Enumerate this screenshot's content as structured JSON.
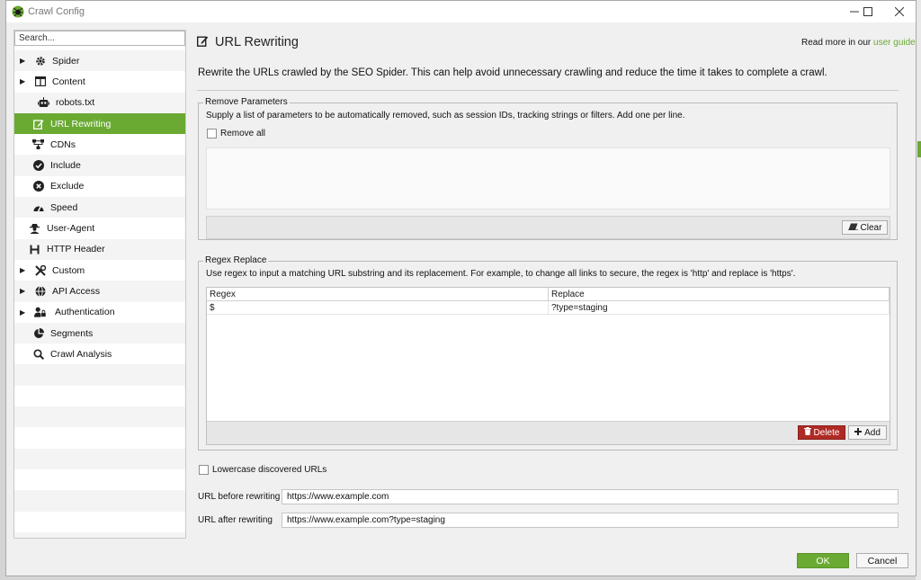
{
  "window": {
    "title": "Crawl Config",
    "controls": [
      "minimize",
      "maximize",
      "close"
    ]
  },
  "sidebar": {
    "search_placeholder": "Search...",
    "items": [
      {
        "label": "Spider",
        "icon": "gear-icon",
        "expandable": true,
        "selected": false
      },
      {
        "label": "Content",
        "icon": "columns-icon",
        "expandable": true,
        "selected": false
      },
      {
        "label": "robots.txt",
        "icon": "robot-icon",
        "expandable": false,
        "selected": false
      },
      {
        "label": "URL Rewriting",
        "icon": "edit-icon",
        "expandable": false,
        "selected": true
      },
      {
        "label": "CDNs",
        "icon": "network-icon",
        "expandable": false,
        "selected": false
      },
      {
        "label": "Include",
        "icon": "check-circle-icon",
        "expandable": false,
        "selected": false
      },
      {
        "label": "Exclude",
        "icon": "x-circle-icon",
        "expandable": false,
        "selected": false
      },
      {
        "label": "Speed",
        "icon": "speedometer-icon",
        "expandable": false,
        "selected": false
      },
      {
        "label": "User-Agent",
        "icon": "user-secret-icon",
        "expandable": false,
        "selected": false
      },
      {
        "label": "HTTP Header",
        "icon": "h-icon",
        "expandable": false,
        "selected": false
      },
      {
        "label": "Custom",
        "icon": "tools-icon",
        "expandable": true,
        "selected": false
      },
      {
        "label": "API Access",
        "icon": "globe-icon",
        "expandable": true,
        "selected": false
      },
      {
        "label": "Authentication",
        "icon": "user-lock-icon",
        "expandable": true,
        "selected": false
      },
      {
        "label": "Segments",
        "icon": "pie-chart-icon",
        "expandable": false,
        "selected": false
      },
      {
        "label": "Crawl Analysis",
        "icon": "search-icon",
        "expandable": false,
        "selected": false
      }
    ]
  },
  "header": {
    "title": "URL Rewriting",
    "read_more_prefix": "Read more in our ",
    "read_more_link": "user guide"
  },
  "description": "Rewrite the URLs crawled by the SEO Spider. This can help avoid unnecessary crawling and reduce the time it takes to complete a crawl.",
  "remove_parameters": {
    "legend": "Remove Parameters",
    "hint": "Supply a list of parameters to be automatically removed, such as session IDs, tracking strings or filters. Add one per line.",
    "remove_all_label": "Remove all",
    "remove_all_checked": false,
    "text_value": "",
    "clear_label": "Clear"
  },
  "regex_replace": {
    "legend": "Regex Replace",
    "hint": "Use regex to input a matching URL substring and its replacement. For example, to change all links to secure, the regex is 'http' and replace is 'https'.",
    "columns": [
      "Regex",
      "Replace"
    ],
    "rows": [
      {
        "regex": "$",
        "replace": "?type=staging"
      }
    ],
    "delete_label": "Delete",
    "add_label": "Add"
  },
  "lowercase": {
    "label": "Lowercase discovered URLs",
    "checked": false
  },
  "test": {
    "before_label": "URL before rewriting",
    "before_value": "https://www.example.com",
    "after_label": "URL after rewriting",
    "after_value": "https://www.example.com?type=staging"
  },
  "footer": {
    "ok_label": "OK",
    "cancel_label": "Cancel"
  },
  "colors": {
    "accent": "#6aaa33",
    "danger": "#b02a25"
  }
}
